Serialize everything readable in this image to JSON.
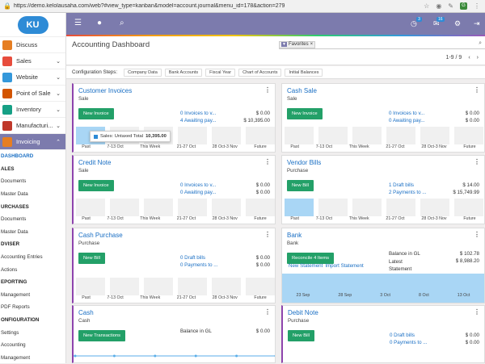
{
  "browser": {
    "url": "https://demo.kelolausaha.com/web?#view_type=kanban&model=account.journal&menu_id=178&action=279"
  },
  "sidebar": {
    "logo": "KU",
    "apps": [
      {
        "label": "Discuss",
        "color": "#e67e22",
        "chevron": false
      },
      {
        "label": "Sales",
        "color": "#e74c3c",
        "chevron": true
      },
      {
        "label": "Website",
        "color": "#3498db",
        "chevron": true
      },
      {
        "label": "Point of Sale",
        "color": "#d35400",
        "chevron": true
      },
      {
        "label": "Inventory",
        "color": "#16a085",
        "chevron": true
      },
      {
        "label": "Manufacturi...",
        "color": "#c0392b",
        "chevron": true
      },
      {
        "label": "Invoicing",
        "color": "#e67e22",
        "chevron": true,
        "active": true
      }
    ],
    "submenu": [
      {
        "label": "DASHBOARD",
        "type": "cur"
      },
      {
        "label": "ALES",
        "type": "head"
      },
      {
        "label": "Documents",
        "type": "item"
      },
      {
        "label": "Master Data",
        "type": "item"
      },
      {
        "label": "URCHASES",
        "type": "head"
      },
      {
        "label": "Documents",
        "type": "item"
      },
      {
        "label": "Master Data",
        "type": "item"
      },
      {
        "label": "DVISER",
        "type": "head"
      },
      {
        "label": "Accounting Entries",
        "type": "item"
      },
      {
        "label": "Actions",
        "type": "item"
      },
      {
        "label": "EPORTING",
        "type": "head"
      },
      {
        "label": "Management",
        "type": "item"
      },
      {
        "label": "PDF Reports",
        "type": "item"
      },
      {
        "label": "ONFIGURATION",
        "type": "head"
      },
      {
        "label": "Settings",
        "type": "item"
      },
      {
        "label": "Accounting",
        "type": "item"
      },
      {
        "label": "Management",
        "type": "item"
      }
    ]
  },
  "topbar": {
    "activity_count": "3",
    "message_count": "16"
  },
  "control": {
    "title": "Accounting Dashboard",
    "facet": "Favorites",
    "pager": "1-9 / 9"
  },
  "steps": {
    "label": "Configuration Steps:",
    "items": [
      "Company Data",
      "Bank Accounts",
      "Fiscal Year",
      "Chart of Accounts",
      "Initial Balances"
    ]
  },
  "cards": [
    {
      "title": "Customer Invoices",
      "subtitle": "Sale",
      "button": "New Invoice",
      "links": [
        "0 Invoices to v...",
        "4 Awaiting pay..."
      ],
      "amounts": [
        "$ 0.00",
        "$ 10,395.00"
      ],
      "chart_labels": [
        "Past",
        "7-13 Oct",
        "This Week",
        "21-27 Oct",
        "28 Oct-3 Nov",
        "Future"
      ],
      "bar_values": [
        10395,
        0,
        0,
        0,
        0,
        0
      ],
      "tooltip": {
        "label": "Sales: Untaxed Total",
        "value": "10,395.00"
      }
    },
    {
      "title": "Cash Sale",
      "subtitle": "Sale",
      "button": "New Invoice",
      "links": [
        "0 Invoices to v...",
        "0 Awaiting pay..."
      ],
      "amounts": [
        "$ 0.00",
        "$ 0.00"
      ],
      "chart_labels": [
        "Past",
        "7-13 Oct",
        "This Week",
        "21-27 Oct",
        "28 Oct-3 Nov",
        "Future"
      ]
    },
    {
      "title": "Credit Note",
      "subtitle": "Sale",
      "button": "New Invoice",
      "links": [
        "0 Invoices to v...",
        "0 Awaiting pay..."
      ],
      "amounts": [
        "$ 0.00",
        "$ 0.00"
      ],
      "chart_labels": [
        "Past",
        "7-13 Oct",
        "This Week",
        "21-27 Oct",
        "28 Oct-3 Nov",
        "Future"
      ]
    },
    {
      "title": "Vendor Bills",
      "subtitle": "Purchase",
      "button": "New Bill",
      "links": [
        "1 Draft bills",
        "2 Payments to ..."
      ],
      "amounts": [
        "$ 14.00",
        "$ 15,749.99"
      ],
      "chart_labels": [
        "Past",
        "7-13 Oct",
        "This Week",
        "21-27 Oct",
        "28 Oct-3 Nov",
        "Future"
      ],
      "bar_values": [
        15749.99,
        0,
        0,
        0,
        0,
        0
      ]
    },
    {
      "title": "Cash Purchase",
      "subtitle": "Purchase",
      "button": "New Bill",
      "links": [
        "0 Draft bills",
        "0 Payments to ..."
      ],
      "amounts": [
        "$ 0.00",
        "$ 0.00"
      ],
      "chart_labels": [
        "Past",
        "7-13 Oct",
        "This Week",
        "21-27 Oct",
        "28 Oct-3 Nov",
        "Future"
      ]
    },
    {
      "title": "Bank",
      "subtitle": "Bank",
      "button": "Reconcile 4 Items",
      "links": [
        "New Statement",
        "Import Statement"
      ],
      "balances": [
        {
          "label": "Balance in GL",
          "value": "$ 102.78"
        },
        {
          "label": "Latest Statement",
          "value": "$ 8,988.20"
        }
      ],
      "chart_labels": [
        "23 Sep",
        "28 Sep",
        "3 Oct",
        "8 Oct",
        "13 Oct"
      ]
    },
    {
      "title": "Cash",
      "subtitle": "Cash",
      "button": "New Transactions",
      "balances": [
        {
          "label": "Balance in GL",
          "value": "$ 0.00"
        }
      ]
    },
    {
      "title": "Debit Note",
      "subtitle": "Purchase",
      "button": "New Bill",
      "links": [
        "0 Draft bills",
        "0 Payments to ..."
      ],
      "amounts": [
        "$ 0.00",
        "$ 0.00"
      ]
    }
  ]
}
